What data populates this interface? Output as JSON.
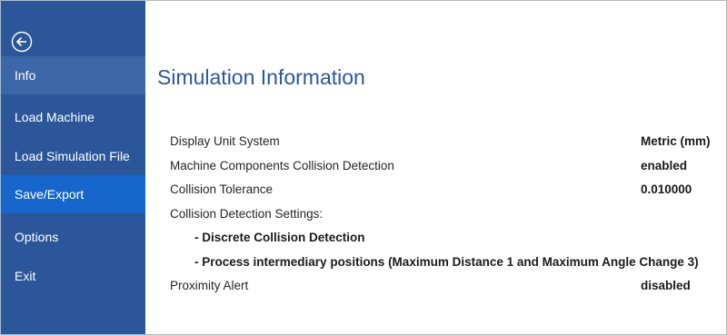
{
  "sidebar": {
    "back_icon": "back-arrow-icon",
    "items": [
      {
        "label": "Info"
      },
      {
        "label": "Load Machine"
      },
      {
        "label": "Load Simulation File"
      },
      {
        "label": "Save/Export"
      },
      {
        "label": "Options"
      },
      {
        "label": "Exit"
      }
    ],
    "colors": {
      "background": "#2b579a",
      "active_item": "#3c67a8",
      "hover_item": "#1766cc"
    }
  },
  "main": {
    "title": "Simulation Information",
    "rows": [
      {
        "label": "Display Unit System",
        "value": "Metric (mm)"
      },
      {
        "label": "Machine Components Collision Detection",
        "value": "enabled"
      },
      {
        "label": "Collision Tolerance",
        "value": "0.010000"
      },
      {
        "label": "Collision Detection Settings:",
        "value": ""
      },
      {
        "label": "Proximity Alert",
        "value": "disabled"
      }
    ],
    "collision_settings": [
      "- Discrete Collision Detection",
      "- Process intermediary positions (Maximum Distance 1 and Maximum Angle Change 3)"
    ],
    "colors": {
      "title": "#2b579a"
    }
  }
}
